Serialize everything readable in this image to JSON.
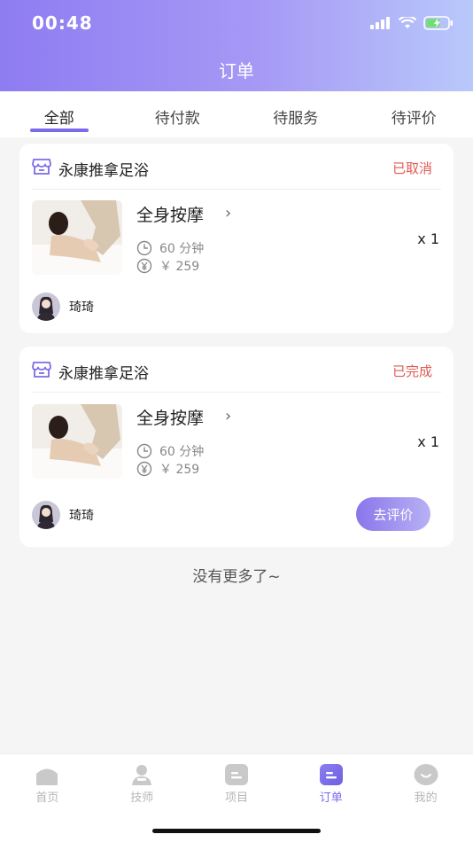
{
  "status_bar": {
    "time": "00:48"
  },
  "header": {
    "title": "订单"
  },
  "tabs": [
    {
      "label": "全部",
      "active": true
    },
    {
      "label": "待付款",
      "active": false
    },
    {
      "label": "待服务",
      "active": false
    },
    {
      "label": "待评价",
      "active": false
    }
  ],
  "orders": [
    {
      "shop_name": "永康推拿足浴",
      "status": "已取消",
      "service_name": "全身按摩",
      "duration": "60 分钟",
      "price": "￥ 259",
      "quantity": "x 1",
      "technician": "琦琦"
    },
    {
      "shop_name": "永康推拿足浴",
      "status": "已完成",
      "service_name": "全身按摩",
      "duration": "60 分钟",
      "price": "￥ 259",
      "quantity": "x 1",
      "technician": "琦琦",
      "action_label": "去评价"
    }
  ],
  "list_end_text": "没有更多了~",
  "tabbar": [
    {
      "label": "首页",
      "icon": "home-icon",
      "active": false
    },
    {
      "label": "技师",
      "icon": "technician-icon",
      "active": false
    },
    {
      "label": "项目",
      "icon": "project-icon",
      "active": false
    },
    {
      "label": "订单",
      "icon": "order-icon",
      "active": true
    },
    {
      "label": "我的",
      "icon": "profile-icon",
      "active": false
    }
  ],
  "colors": {
    "accent": "#7a6ce8",
    "status_cancelled": "#e05a52",
    "status_done": "#e05a52"
  }
}
